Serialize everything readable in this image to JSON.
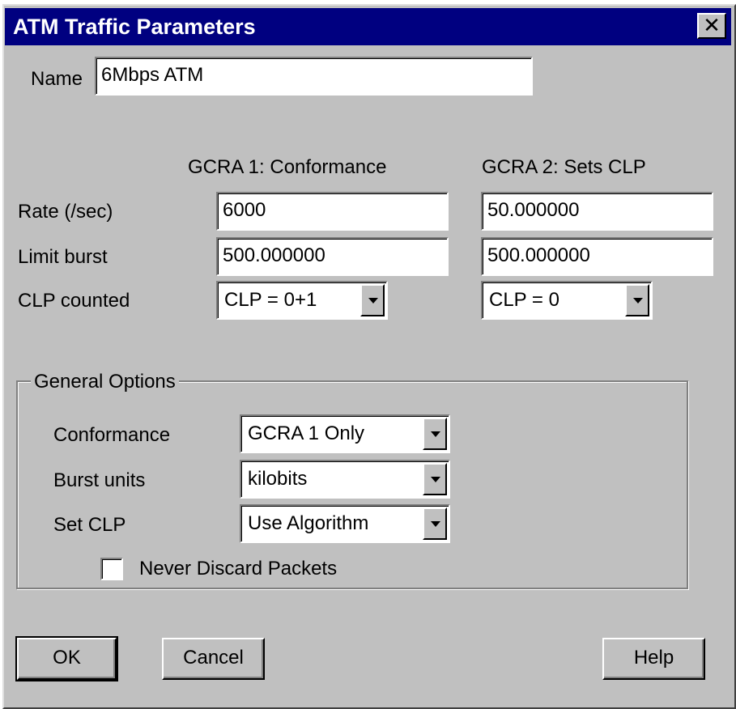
{
  "window": {
    "title": "ATM Traffic Parameters",
    "close_glyph": "✕"
  },
  "name": {
    "label": "Name",
    "value": "6Mbps ATM"
  },
  "columns": {
    "gcra1": "GCRA 1: Conformance",
    "gcra2": "GCRA 2: Sets CLP"
  },
  "rows": {
    "rate": {
      "label": "Rate (/sec)",
      "gcra1": "6000",
      "gcra2": "50.000000"
    },
    "limit_burst": {
      "label": "Limit burst",
      "gcra1": "500.000000",
      "gcra2": "500.000000"
    },
    "clp_counted": {
      "label": "CLP counted",
      "gcra1": "CLP = 0+1",
      "gcra2": "CLP = 0"
    }
  },
  "general_options": {
    "legend": "General Options",
    "conformance": {
      "label": "Conformance",
      "value": "GCRA 1 Only"
    },
    "burst_units": {
      "label": "Burst units",
      "value": "kilobits"
    },
    "set_clp": {
      "label": "Set CLP",
      "value": "Use Algorithm"
    },
    "never_discard": {
      "label": "Never Discard Packets",
      "checked": false
    }
  },
  "buttons": {
    "ok": "OK",
    "cancel": "Cancel",
    "help": "Help"
  },
  "icons": {
    "close": "close-icon",
    "dropdown": "chevron-down-icon"
  },
  "colors": {
    "titlebar": "#000080",
    "face": "#c0c0c0"
  }
}
